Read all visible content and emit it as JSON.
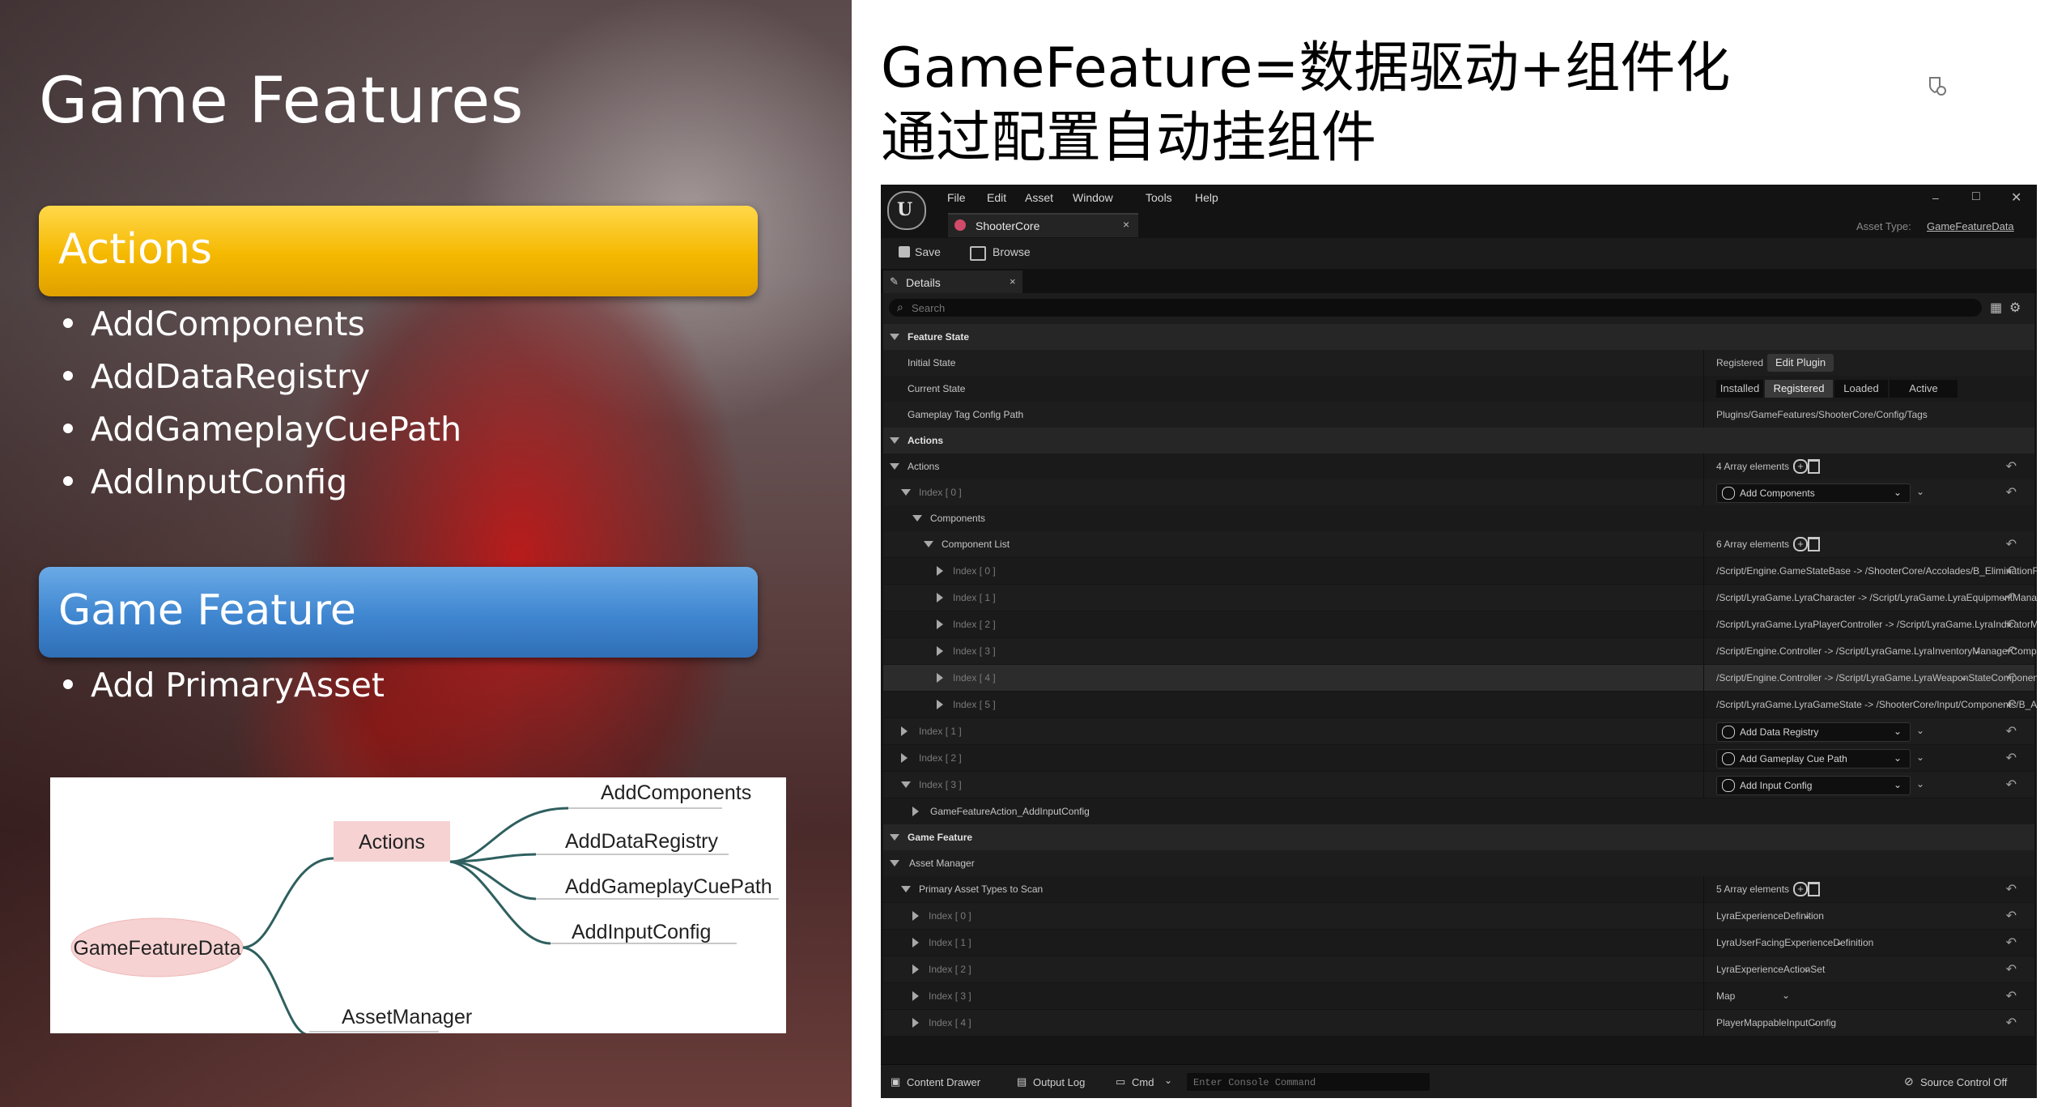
{
  "slide": {
    "title": "Game Features",
    "actions_band": "Actions",
    "actions_bullets": [
      "AddComponents",
      "AddDataRegistry",
      "AddGameplayCuePath",
      "AddInputConfig"
    ],
    "feature_band": "Game Feature",
    "feature_bullets": [
      "Add PrimaryAsset"
    ],
    "colors": {
      "actions_band": "#f5b800",
      "feature_band": "#3f86d0"
    },
    "mindmap": {
      "root": "GameFeatureData",
      "actions": "Actions",
      "action_children": [
        "AddComponents",
        "AddDataRegistry",
        "AddGameplayCuePath",
        "AddInputConfig"
      ],
      "asset_manager": "AssetManager"
    }
  },
  "headline": {
    "line1": "GameFeature=数据驱动+组件化",
    "line2": "通过配置自动挂组件"
  },
  "editor": {
    "menu": [
      "File",
      "Edit",
      "Asset",
      "Window",
      "Tools",
      "Help"
    ],
    "tab": "ShooterCore",
    "tab_close": "×",
    "asset_type_label": "Asset Type:",
    "asset_type_value": "GameFeatureData",
    "window_controls": [
      "–",
      "□",
      "✕"
    ],
    "toolbar": {
      "save": "Save",
      "browse": "Browse"
    },
    "details_tab": "Details",
    "search_placeholder": "Search",
    "feature_state": {
      "header": "Feature State",
      "initial_state_label": "Initial State",
      "initial_state_value": "Registered",
      "edit_plugin": "Edit Plugin",
      "current_state_label": "Current State",
      "states": [
        "Installed",
        "Registered",
        "Loaded",
        "Active"
      ],
      "active_state": "Registered",
      "tag_path_label": "Gameplay Tag Config Path",
      "tag_path_value": "Plugins/GameFeatures/ShooterCore/Config/Tags"
    },
    "actions": {
      "header": "Actions",
      "label": "Actions",
      "count": "4 Array elements",
      "index0_label": "Index [ 0 ]",
      "index0_value": "Add Components",
      "components_label": "Components",
      "component_list_label": "Component List",
      "component_list_count": "6 Array elements",
      "component_list": [
        {
          "index": "Index [ 0 ]",
          "value": "/Script/Engine.GameStateBase -> /ShooterCore/Accolades/B_EliminationFeedRelay.B_Elim"
        },
        {
          "index": "Index [ 1 ]",
          "value": "/Script/LyraGame.LyraCharacter -> /Script/LyraGame.LyraEquipmentManagerComponent"
        },
        {
          "index": "Index [ 2 ]",
          "value": "/Script/LyraGame.LyraPlayerController -> /Script/LyraGame.LyraIndicatorManagerCompon"
        },
        {
          "index": "Index [ 3 ]",
          "value": "/Script/Engine.Controller -> /Script/LyraGame.LyraInventoryManagerComponent"
        },
        {
          "index": "Index [ 4 ]",
          "value": "/Script/Engine.Controller -> /Script/LyraGame.LyraWeaponStateComponent"
        },
        {
          "index": "Index [ 5 ]",
          "value": "/Script/LyraGame.LyraGameState -> /ShooterCore/Input/Components/B_AimAssistTargetf"
        }
      ],
      "other_actions": [
        {
          "index": "Index [ 1 ]",
          "value": "Add Data Registry"
        },
        {
          "index": "Index [ 2 ]",
          "value": "Add Gameplay Cue Path"
        },
        {
          "index": "Index [ 3 ]",
          "value": "Add Input Config"
        }
      ],
      "sub_item": "GameFeatureAction_AddInputConfig"
    },
    "game_feature": {
      "header": "Game Feature",
      "asset_manager": "Asset Manager",
      "primary_label": "Primary Asset Types to Scan",
      "primary_count": "5 Array elements",
      "primary_list": [
        {
          "index": "Index [ 0 ]",
          "value": "LyraExperienceDefinition"
        },
        {
          "index": "Index [ 1 ]",
          "value": "LyraUserFacingExperienceDefinition"
        },
        {
          "index": "Index [ 2 ]",
          "value": "LyraExperienceActionSet"
        },
        {
          "index": "Index [ 3 ]",
          "value": "Map"
        },
        {
          "index": "Index [ 4 ]",
          "value": "PlayerMappableInputConfig"
        }
      ]
    },
    "statusbar": {
      "content_drawer": "Content Drawer",
      "output_log": "Output Log",
      "cmd": "Cmd",
      "console_placeholder": "Enter Console Command",
      "source_control": "Source Control Off"
    }
  }
}
